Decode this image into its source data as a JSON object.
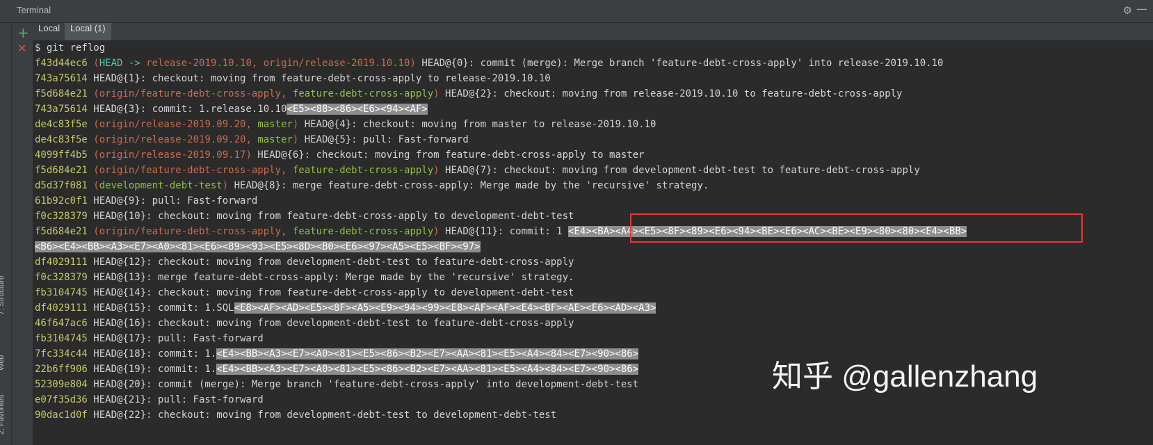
{
  "window": {
    "title": "Terminal"
  },
  "tabs": [
    {
      "label": "Local"
    },
    {
      "label": "Local (1)"
    }
  ],
  "side_tabs": [
    {
      "label": "7: Structure"
    },
    {
      "label": "Web"
    },
    {
      "label": "2: Favorites"
    }
  ],
  "terminal": {
    "prompt": "$ git reflog",
    "lines": [
      {
        "hash": "f43d44ec6",
        "paren_open": " (",
        "head": "HEAD -> ",
        "ref1": "release-2019.10.10",
        "sep": ", ",
        "ref2": "origin/release-2019.10.10",
        "paren_close": ")",
        "text": " HEAD@{0}: commit (merge): Merge branch 'feature-debt-cross-apply' into release-2019.10.10"
      },
      {
        "hash": "743a75614",
        "text": " HEAD@{1}: checkout: moving from feature-debt-cross-apply to release-2019.10.10"
      },
      {
        "hash": "f5d684e21",
        "paren_open": " (",
        "ref1": "origin/feature-debt-cross-apply",
        "sep": ", ",
        "ref2": "feature-debt-cross-apply",
        "paren_close": ")",
        "text": " HEAD@{2}: checkout: moving from release-2019.10.10 to feature-debt-cross-apply"
      },
      {
        "hash": "743a75614",
        "text": " HEAD@{3}: commit: 1.release.10.10",
        "sel": "<E5><88><86><E6><94><AF>"
      },
      {
        "hash": "de4c83f5e",
        "paren_open": " (",
        "ref1": "origin/release-2019.09.20",
        "sep": ", ",
        "ref2": "master",
        "paren_close": ")",
        "text": " HEAD@{4}: checkout: moving from master to release-2019.10.10"
      },
      {
        "hash": "de4c83f5e",
        "paren_open": " (",
        "ref1": "origin/release-2019.09.20",
        "sep": ", ",
        "ref2": "master",
        "paren_close": ")",
        "text": " HEAD@{5}: pull: Fast-forward"
      },
      {
        "hash": "4099ff4b5",
        "paren_open": " (",
        "ref1": "origin/release-2019.09.17",
        "paren_close": ")",
        "text": " HEAD@{6}: checkout: moving from feature-debt-cross-apply to master"
      },
      {
        "hash": "f5d684e21",
        "paren_open": " (",
        "ref1": "origin/feature-debt-cross-apply",
        "sep": ", ",
        "ref2": "feature-debt-cross-apply",
        "paren_close": ")",
        "text": " HEAD@{7}: checkout: moving from development-debt-test to feature-debt-cross-apply"
      },
      {
        "hash": "d5d37f081",
        "paren_open": " (",
        "ref2": "development-debt-test",
        "paren_close": ")",
        "text": " HEAD@{8}: merge feature-debt-cross-apply: Merge made by the 'recursive' strategy."
      },
      {
        "hash": "61b92c0f1",
        "text": " HEAD@{9}: pull: Fast-forward"
      },
      {
        "hash": "f0c328379",
        "text": " HEAD@{10}: checkout: moving from feature-debt-cross-apply to development-debt-test"
      },
      {
        "hash": "f5d684e21",
        "paren_open": " (",
        "ref1": "origin/feature-debt-cross-apply",
        "sep": ", ",
        "ref2": "feature-debt-cross-apply",
        "paren_close": ")",
        "text": " HEAD@{11}: commit: 1 ",
        "sel": "<E4><BA><A4><E5><8F><89><E6><94><BE><E6><AC><BE><E9><80><80><E4><BB>"
      },
      {
        "wrap": "<B6><E4><BB><A3><E7><A0><81><E6><89><93><E5><8D><B0><E6><97><A5><E5><BF><97>"
      },
      {
        "hash": "df4029111",
        "text": " HEAD@{12}: checkout: moving from development-debt-test to feature-debt-cross-apply"
      },
      {
        "hash": "f0c328379",
        "text": " HEAD@{13}: merge feature-debt-cross-apply: Merge made by the 'recursive' strategy."
      },
      {
        "hash": "fb3104745",
        "text": " HEAD@{14}: checkout: moving from feature-debt-cross-apply to development-debt-test"
      },
      {
        "hash": "df4029111",
        "text": " HEAD@{15}: commit: 1.SQL",
        "sel": "<E8><AF><AD><E5><8F><A5><E9><94><99><E8><AF><AF><E4><BF><AE><E6><AD><A3>"
      },
      {
        "hash": "46f647ac6",
        "text": " HEAD@{16}: checkout: moving from development-debt-test to feature-debt-cross-apply"
      },
      {
        "hash": "fb3104745",
        "text": " HEAD@{17}: pull: Fast-forward"
      },
      {
        "hash": "7fc334c44",
        "text": " HEAD@{18}: commit: 1.",
        "sel": "<E4><BB><A3><E7><A0><81><E5><86><B2><E7><AA><81><E5><A4><84><E7><90><86>"
      },
      {
        "hash": "22b6ff906",
        "text": " HEAD@{19}: commit: 1.",
        "sel": "<E4><BB><A3><E7><A0><81><E5><86><B2><E7><AA><81><E5><A4><84><E7><90><86>"
      },
      {
        "hash": "52309e804",
        "text": " HEAD@{20}: commit (merge): Merge branch 'feature-debt-cross-apply' into development-debt-test"
      },
      {
        "hash": "e07f35d36",
        "text": " HEAD@{21}: pull: Fast-forward"
      },
      {
        "hash": "90dac1d0f",
        "text": " HEAD@{22}: checkout: moving from development-debt-test to development-debt-test"
      }
    ]
  },
  "watermark": "知乎 @gallenzhang",
  "colors": {
    "background": "#2b2b2b",
    "hash": "#c5c76b",
    "head": "#4ec9b0",
    "origin_ref": "#c96b4f",
    "local_ref": "#8fc045",
    "selection": "#8d8d8d",
    "highlight_box": "#e53935"
  }
}
